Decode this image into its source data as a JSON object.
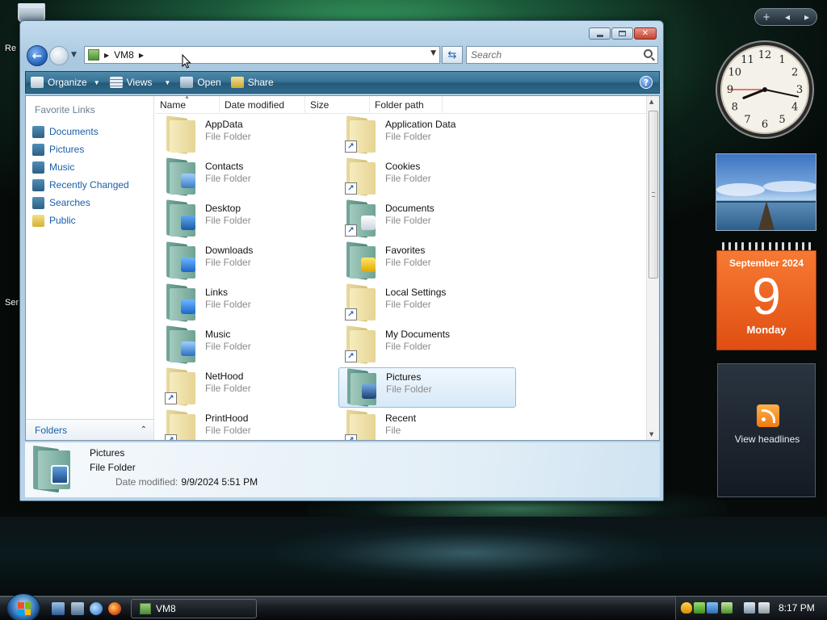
{
  "desktop": {
    "left_labels": [
      "Re",
      "Ser"
    ]
  },
  "window": {
    "address": {
      "location": "VM8"
    },
    "search": {
      "placeholder": "Search"
    },
    "toolbar": {
      "organize_label": "Organize",
      "views_label": "Views",
      "open_label": "Open",
      "share_label": "Share",
      "help_label": "?"
    },
    "sidebar": {
      "heading": "Favorite Links",
      "items": [
        {
          "label": "Documents",
          "icon": "documents-icon",
          "color": "#4f8fb8"
        },
        {
          "label": "Pictures",
          "icon": "pictures-icon",
          "color": "#4f8fb8"
        },
        {
          "label": "Music",
          "icon": "music-icon",
          "color": "#4f8fb8"
        },
        {
          "label": "Recently Changed",
          "icon": "recently-changed-icon",
          "color": "#4f8fb8"
        },
        {
          "label": "Searches",
          "icon": "searches-icon",
          "color": "#4f8fb8"
        },
        {
          "label": "Public",
          "icon": "public-folder-icon",
          "color": "#e3c44e"
        }
      ],
      "folders_label": "Folders"
    },
    "columns": [
      "Name",
      "Date modified",
      "Size",
      "Folder path"
    ],
    "files": [
      {
        "name": "AppData",
        "type": "File Folder",
        "style": "plain",
        "shortcut": false,
        "selected": false
      },
      {
        "name": "Application Data",
        "type": "File Folder",
        "style": "plain",
        "shortcut": true,
        "selected": false
      },
      {
        "name": "Contacts",
        "type": "File Folder",
        "style": "teal",
        "shortcut": false,
        "selected": false
      },
      {
        "name": "Cookies",
        "type": "File Folder",
        "style": "plain",
        "shortcut": true,
        "selected": false
      },
      {
        "name": "Desktop",
        "type": "File Folder",
        "style": "teal",
        "shortcut": false,
        "selected": false
      },
      {
        "name": "Documents",
        "type": "File Folder",
        "style": "teal",
        "shortcut": true,
        "selected": false
      },
      {
        "name": "Downloads",
        "type": "File Folder",
        "style": "teal",
        "shortcut": false,
        "selected": false
      },
      {
        "name": "Favorites",
        "type": "File Folder",
        "style": "teal",
        "shortcut": false,
        "selected": false
      },
      {
        "name": "Links",
        "type": "File Folder",
        "style": "teal",
        "shortcut": false,
        "selected": false
      },
      {
        "name": "Local Settings",
        "type": "File Folder",
        "style": "plain",
        "shortcut": true,
        "selected": false
      },
      {
        "name": "Music",
        "type": "File Folder",
        "style": "teal",
        "shortcut": false,
        "selected": false
      },
      {
        "name": "My Documents",
        "type": "File Folder",
        "style": "plain",
        "shortcut": true,
        "selected": false
      },
      {
        "name": "NetHood",
        "type": "File Folder",
        "style": "plain",
        "shortcut": true,
        "selected": false
      },
      {
        "name": "Pictures",
        "type": "File Folder",
        "style": "teal",
        "shortcut": false,
        "selected": true
      },
      {
        "name": "PrintHood",
        "type": "File Folder",
        "style": "plain",
        "shortcut": true,
        "selected": false
      },
      {
        "name": "Recent",
        "type": "File",
        "style": "plain",
        "shortcut": true,
        "selected": false
      }
    ],
    "details": {
      "name": "Pictures",
      "type": "File Folder",
      "date_label": "Date modified:",
      "date_value": "9/9/2024 5:51 PM"
    }
  },
  "gadgets": {
    "controls": {
      "add": "+",
      "prev": "◂",
      "next": "▸"
    },
    "clock": {
      "hour": 8,
      "minute": 17,
      "second": 45
    },
    "calendar": {
      "month_year": "September 2024",
      "day": "9",
      "weekday": "Monday"
    },
    "feed": {
      "label": "View headlines"
    }
  },
  "taskbar": {
    "task_label": "VM8",
    "time": "8:17 PM"
  }
}
